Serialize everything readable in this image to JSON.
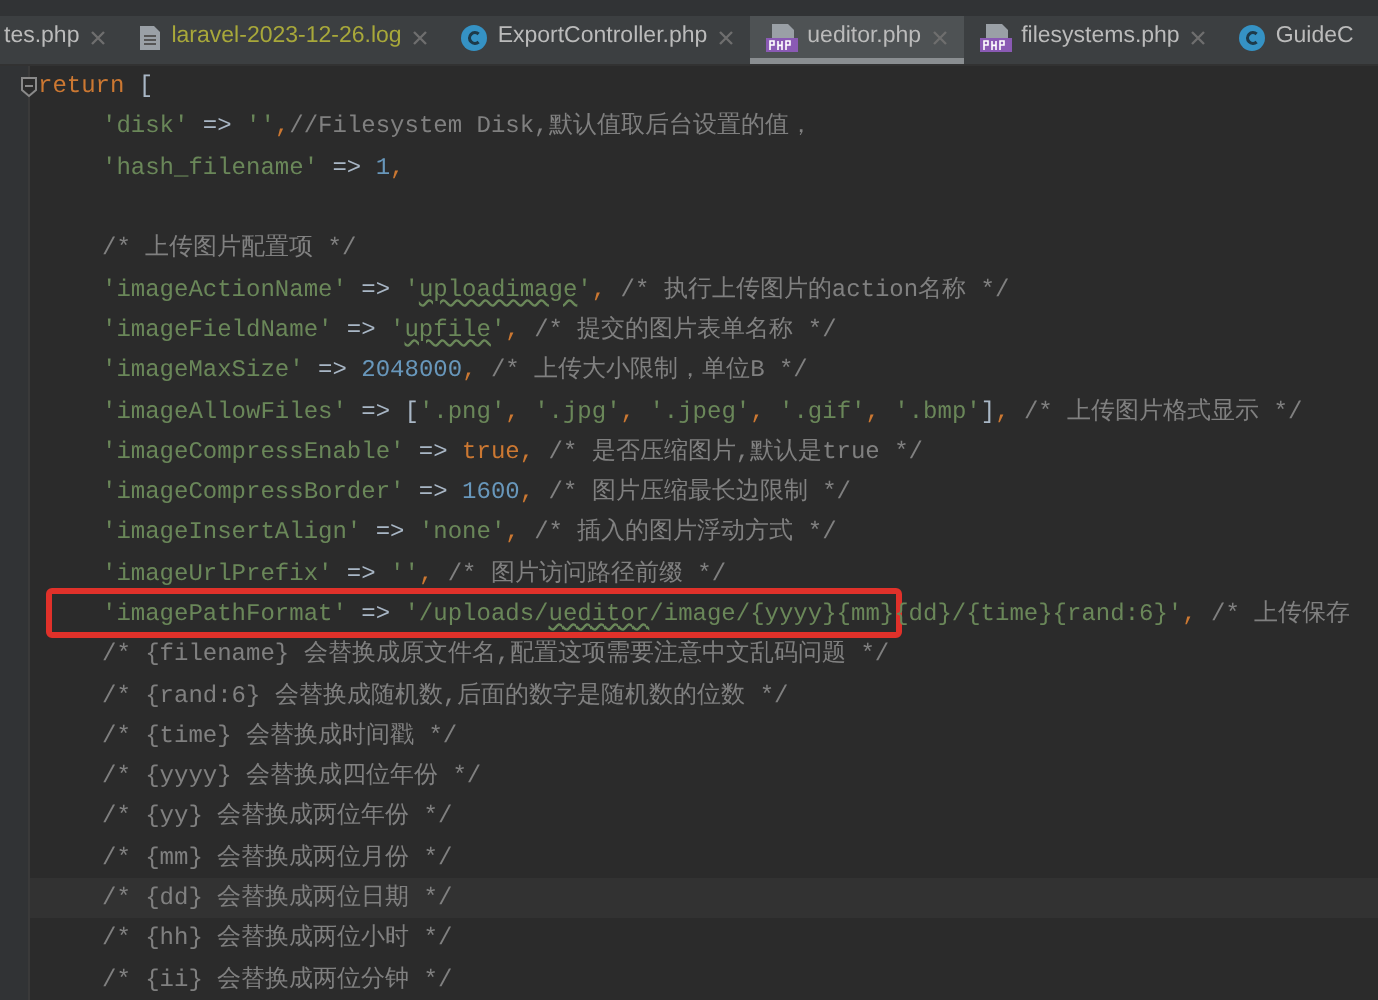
{
  "tabs": [
    {
      "label": "tes.php",
      "kind": "php-plain",
      "selected": false
    },
    {
      "label": "laravel-2023-12-26.log",
      "kind": "log",
      "selected": false
    },
    {
      "label": "ExportController.php",
      "kind": "class",
      "selected": false
    },
    {
      "label": "ueditor.php",
      "kind": "php",
      "selected": true
    },
    {
      "label": "filesystems.php",
      "kind": "php",
      "selected": false
    },
    {
      "label": "GuideC",
      "kind": "class",
      "selected": false
    }
  ],
  "code": [
    {
      "tokens": [
        {
          "kind": "keyword",
          "text": "return"
        },
        {
          "kind": "plain",
          "text": " ["
        }
      ],
      "current": false,
      "boxed": false,
      "children": [
        {
          "tokens": [
            {
              "kind": "string",
              "text": "'disk'"
            },
            {
              "kind": "plain",
              "text": " => "
            },
            {
              "kind": "string",
              "text": "''"
            },
            {
              "kind": "keyword",
              "text": ","
            },
            {
              "kind": "comment",
              "text": "//Filesystem Disk,默认值取后台设置的值，"
            }
          ],
          "current": false,
          "boxed": false
        },
        {
          "tokens": [
            {
              "kind": "string",
              "text": "'hash_filename'"
            },
            {
              "kind": "plain",
              "text": " => "
            },
            {
              "kind": "number",
              "text": "1"
            },
            {
              "kind": "keyword",
              "text": ","
            }
          ],
          "current": false,
          "boxed": false
        },
        {
          "current": false,
          "boxed": false
        },
        {
          "tokens": [
            {
              "kind": "comment",
              "text": "/* 上传图片配置项 */"
            }
          ],
          "current": false,
          "boxed": false
        },
        {
          "tokens": [
            {
              "kind": "string",
              "text": "'imageActionName'"
            },
            {
              "kind": "plain",
              "text": " => "
            },
            {
              "kind": "string",
              "text": "'"
            },
            {
              "kind": "typo",
              "text": "uploadimage"
            },
            {
              "kind": "string",
              "text": "'"
            },
            {
              "kind": "keyword",
              "text": ", "
            },
            {
              "kind": "comment",
              "text": "/* 执行上传图片的action名称 */"
            }
          ],
          "current": false,
          "boxed": false
        },
        {
          "tokens": [
            {
              "kind": "string",
              "text": "'imageFieldName'"
            },
            {
              "kind": "plain",
              "text": " => "
            },
            {
              "kind": "string",
              "text": "'"
            },
            {
              "kind": "typo",
              "text": "upfile"
            },
            {
              "kind": "string",
              "text": "'"
            },
            {
              "kind": "keyword",
              "text": ", "
            },
            {
              "kind": "comment",
              "text": "/* 提交的图片表单名称 */"
            }
          ],
          "current": false,
          "boxed": false
        },
        {
          "tokens": [
            {
              "kind": "string",
              "text": "'imageMaxSize'"
            },
            {
              "kind": "plain",
              "text": " => "
            },
            {
              "kind": "number",
              "text": "2048000"
            },
            {
              "kind": "keyword",
              "text": ", "
            },
            {
              "kind": "comment",
              "text": "/* 上传大小限制，单位B */"
            }
          ],
          "current": false,
          "boxed": false
        },
        {
          "tokens": [
            {
              "kind": "string",
              "text": "'imageAllowFiles'"
            },
            {
              "kind": "plain",
              "text": " => ["
            },
            {
              "kind": "string",
              "text": "'.png'"
            },
            {
              "kind": "keyword",
              "text": ", "
            },
            {
              "kind": "string",
              "text": "'.jpg'"
            },
            {
              "kind": "keyword",
              "text": ", "
            },
            {
              "kind": "string",
              "text": "'.jpeg'"
            },
            {
              "kind": "keyword",
              "text": ", "
            },
            {
              "kind": "string",
              "text": "'.gif'"
            },
            {
              "kind": "keyword",
              "text": ", "
            },
            {
              "kind": "string",
              "text": "'.bmp'"
            },
            {
              "kind": "plain",
              "text": "]"
            },
            {
              "kind": "keyword",
              "text": ", "
            },
            {
              "kind": "comment",
              "text": "/* 上传图片格式显示 */"
            }
          ],
          "current": false,
          "boxed": false
        },
        {
          "tokens": [
            {
              "kind": "string",
              "text": "'imageCompressEnable'"
            },
            {
              "kind": "plain",
              "text": " => "
            },
            {
              "kind": "keyword",
              "text": "true, "
            },
            {
              "kind": "comment",
              "text": "/* 是否压缩图片,默认是true */"
            }
          ],
          "current": false,
          "boxed": false
        },
        {
          "tokens": [
            {
              "kind": "string",
              "text": "'imageCompressBorder'"
            },
            {
              "kind": "plain",
              "text": " => "
            },
            {
              "kind": "number",
              "text": "1600"
            },
            {
              "kind": "keyword",
              "text": ", "
            },
            {
              "kind": "comment",
              "text": "/* 图片压缩最长边限制 */"
            }
          ],
          "current": false,
          "boxed": false
        },
        {
          "tokens": [
            {
              "kind": "string",
              "text": "'imageInsertAlign'"
            },
            {
              "kind": "plain",
              "text": " => "
            },
            {
              "kind": "string",
              "text": "'none'"
            },
            {
              "kind": "keyword",
              "text": ", "
            },
            {
              "kind": "comment",
              "text": "/* 插入的图片浮动方式 */"
            }
          ],
          "current": false,
          "boxed": false
        },
        {
          "tokens": [
            {
              "kind": "string",
              "text": "'imageUrlPrefix'"
            },
            {
              "kind": "plain",
              "text": " => "
            },
            {
              "kind": "string",
              "text": "''"
            },
            {
              "kind": "keyword",
              "text": ", "
            },
            {
              "kind": "comment",
              "text": "/* 图片访问路径前缀 */"
            }
          ],
          "current": false,
          "boxed": false
        },
        {
          "tokens": [
            {
              "kind": "string",
              "text": "'imagePathFormat'"
            },
            {
              "kind": "plain",
              "text": " => "
            },
            {
              "kind": "string",
              "text": "'/uploads/"
            },
            {
              "kind": "typo",
              "text": "ueditor"
            },
            {
              "kind": "string",
              "text": "/image/{yyyy}{mm}"
            },
            {
              "kind": "string",
              "text": "{dd}/{time}{rand:6}'"
            },
            {
              "kind": "keyword",
              "text": ", "
            },
            {
              "kind": "comment",
              "text": "/* 上传保存"
            }
          ],
          "current": false,
          "boxed": true
        },
        {
          "tokens": [
            {
              "kind": "comment",
              "text": "/* {filename} 会替换成原文件名,配置这项需要注意中文乱码问题 */"
            }
          ],
          "current": false,
          "boxed": false
        },
        {
          "tokens": [
            {
              "kind": "comment",
              "text": "/* {rand:6} 会替换成随机数,后面的数字是随机数的位数 */"
            }
          ],
          "current": false,
          "boxed": false
        },
        {
          "tokens": [
            {
              "kind": "comment",
              "text": "/* {time} 会替换成时间戳 */"
            }
          ],
          "current": false,
          "boxed": false
        },
        {
          "tokens": [
            {
              "kind": "comment",
              "text": "/* {yyyy} 会替换成四位年份 */"
            }
          ],
          "current": false,
          "boxed": false
        },
        {
          "tokens": [
            {
              "kind": "comment",
              "text": "/* {yy} 会替换成两位年份 */"
            }
          ],
          "current": false,
          "boxed": false
        },
        {
          "tokens": [
            {
              "kind": "comment",
              "text": "/* {mm} 会替换成两位月份 */"
            }
          ],
          "current": false,
          "boxed": false
        },
        {
          "tokens": [
            {
              "kind": "comment",
              "text": "/* {dd} 会替换成两位日期 */"
            }
          ],
          "current": true,
          "boxed": false
        },
        {
          "tokens": [
            {
              "kind": "comment",
              "text": "/* {hh} 会替换成两位小时 */"
            }
          ],
          "current": false,
          "boxed": false
        },
        {
          "tokens": [
            {
              "kind": "comment",
              "text": "/* {ii} 会替换成两位分钟 */"
            }
          ],
          "current": false,
          "boxed": false
        }
      ]
    }
  ]
}
